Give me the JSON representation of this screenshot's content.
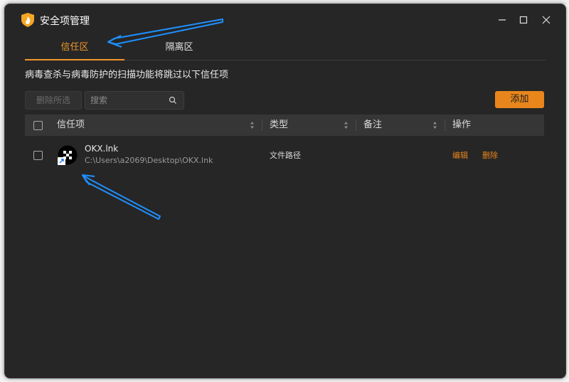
{
  "window": {
    "title": "安全项管理",
    "controls": [
      "minimize-icon",
      "maximize-icon",
      "close-icon"
    ]
  },
  "tabs": [
    {
      "label": "信任区",
      "active": true
    },
    {
      "label": "隔离区",
      "active": false
    }
  ],
  "description": "病毒查杀与病毒防护的扫描功能将跳过以下信任项",
  "toolbar": {
    "delete_selected_label": "删除所选",
    "search_placeholder": "搜索",
    "add_label": "添加"
  },
  "table": {
    "columns": [
      "信任项",
      "类型",
      "备注",
      "操作"
    ],
    "rows": [
      {
        "name": "OKX.lnk",
        "path": "C:\\Users\\a2069\\Desktop\\OKX.lnk",
        "type": "文件路径",
        "note": "",
        "actions": {
          "edit": "编辑",
          "delete": "删除"
        }
      }
    ]
  },
  "colors": {
    "accent": "#e8861c",
    "window_bg": "#262626",
    "header_bg": "#363636",
    "annotation_arrow": "#1e90ff"
  }
}
